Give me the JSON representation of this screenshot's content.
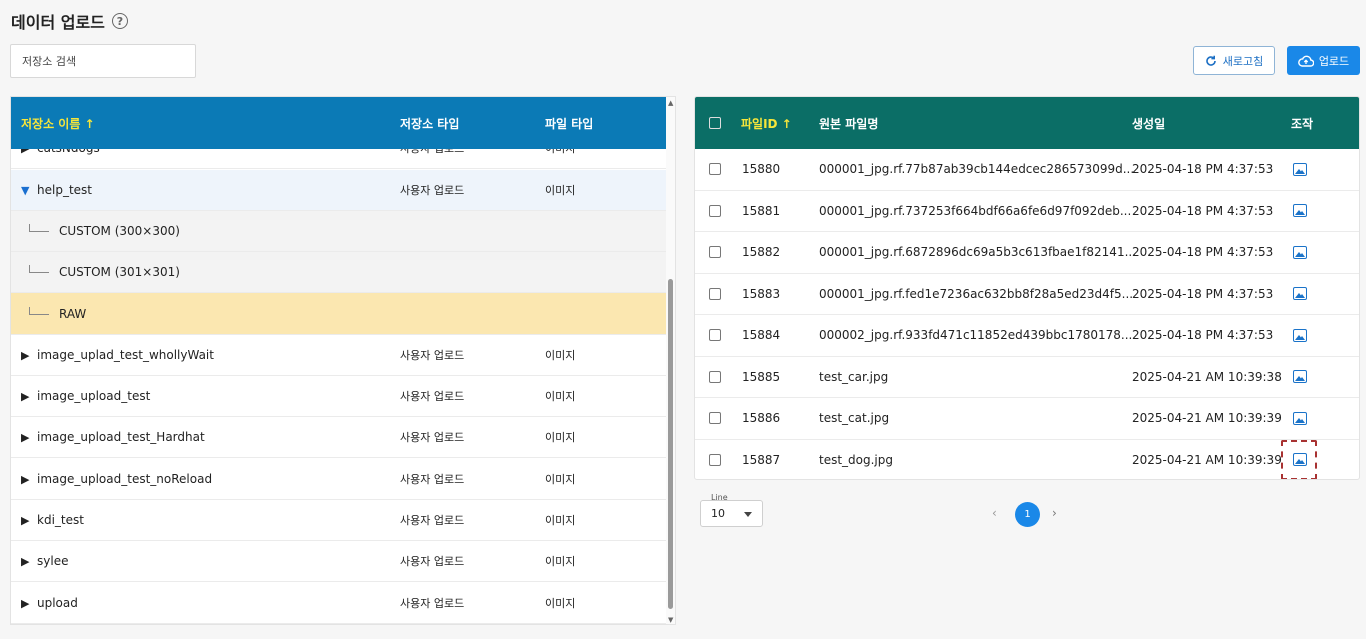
{
  "page": {
    "title": "데이터 업로드",
    "help_icon": "question-circle-icon"
  },
  "search": {
    "placeholder": "저장소 검색"
  },
  "toolbar": {
    "refresh_label": "새로고침",
    "upload_label": "업로드"
  },
  "repo_table": {
    "headers": {
      "name": "저장소 이름 ↑",
      "type": "저장소 타입",
      "file_type": "파일 타입"
    },
    "partial_top_row": {
      "name": "catsNdogs",
      "type": "사용자 업로드",
      "file_type": "이미지"
    },
    "rows": [
      {
        "name": "help_test",
        "type": "사용자 업로드",
        "file_type": "이미지",
        "expanded": true
      },
      {
        "name": "CUSTOM (300×300)",
        "child": true
      },
      {
        "name": "CUSTOM (301×301)",
        "child": true
      },
      {
        "name": "RAW",
        "child": true,
        "selected": true
      },
      {
        "name": "image_uplad_test_whollyWait",
        "type": "사용자 업로드",
        "file_type": "이미지"
      },
      {
        "name": "image_upload_test",
        "type": "사용자 업로드",
        "file_type": "이미지"
      },
      {
        "name": "image_upload_test_Hardhat",
        "type": "사용자 업로드",
        "file_type": "이미지"
      },
      {
        "name": "image_upload_test_noReload",
        "type": "사용자 업로드",
        "file_type": "이미지"
      },
      {
        "name": "kdi_test",
        "type": "사용자 업로드",
        "file_type": "이미지"
      },
      {
        "name": "sylee",
        "type": "사용자 업로드",
        "file_type": "이미지"
      },
      {
        "name": "upload",
        "type": "사용자 업로드",
        "file_type": "이미지"
      }
    ]
  },
  "file_table": {
    "headers": {
      "file_id": "파일ID ↑",
      "original_name": "원본 파일명",
      "created": "생성일",
      "action": "조작"
    },
    "rows": [
      {
        "id": "15880",
        "name": "000001_jpg.rf.77b87ab39cb144edcec286573099d...",
        "created": "2025-04-18 PM 4:37:53"
      },
      {
        "id": "15881",
        "name": "000001_jpg.rf.737253f664bdf66a6fe6d97f092deb...",
        "created": "2025-04-18 PM 4:37:53"
      },
      {
        "id": "15882",
        "name": "000001_jpg.rf.6872896dc69a5b3c613fbae1f82141...",
        "created": "2025-04-18 PM 4:37:53"
      },
      {
        "id": "15883",
        "name": "000001_jpg.rf.fed1e7236ac632bb8f28a5ed23d4f5...",
        "created": "2025-04-18 PM 4:37:53"
      },
      {
        "id": "15884",
        "name": "000002_jpg.rf.933fd471c11852ed439bbc1780178...",
        "created": "2025-04-18 PM 4:37:53"
      },
      {
        "id": "15885",
        "name": "test_car.jpg",
        "created": "2025-04-21 AM 10:39:38"
      },
      {
        "id": "15886",
        "name": "test_cat.jpg",
        "created": "2025-04-21 AM 10:39:39"
      },
      {
        "id": "15887",
        "name": "test_dog.jpg",
        "created": "2025-04-21 AM 10:39:39"
      }
    ]
  },
  "pagination": {
    "line_label": "Line",
    "line_value": "10",
    "current_page": "1"
  },
  "colors": {
    "repo_header": "#0b7ab6",
    "file_header": "#0b6e66",
    "sort_accent": "#f7e63a",
    "primary": "#1a88e8",
    "selected_row": "#fbe7b0",
    "expanded_row": "#eef4fb"
  }
}
